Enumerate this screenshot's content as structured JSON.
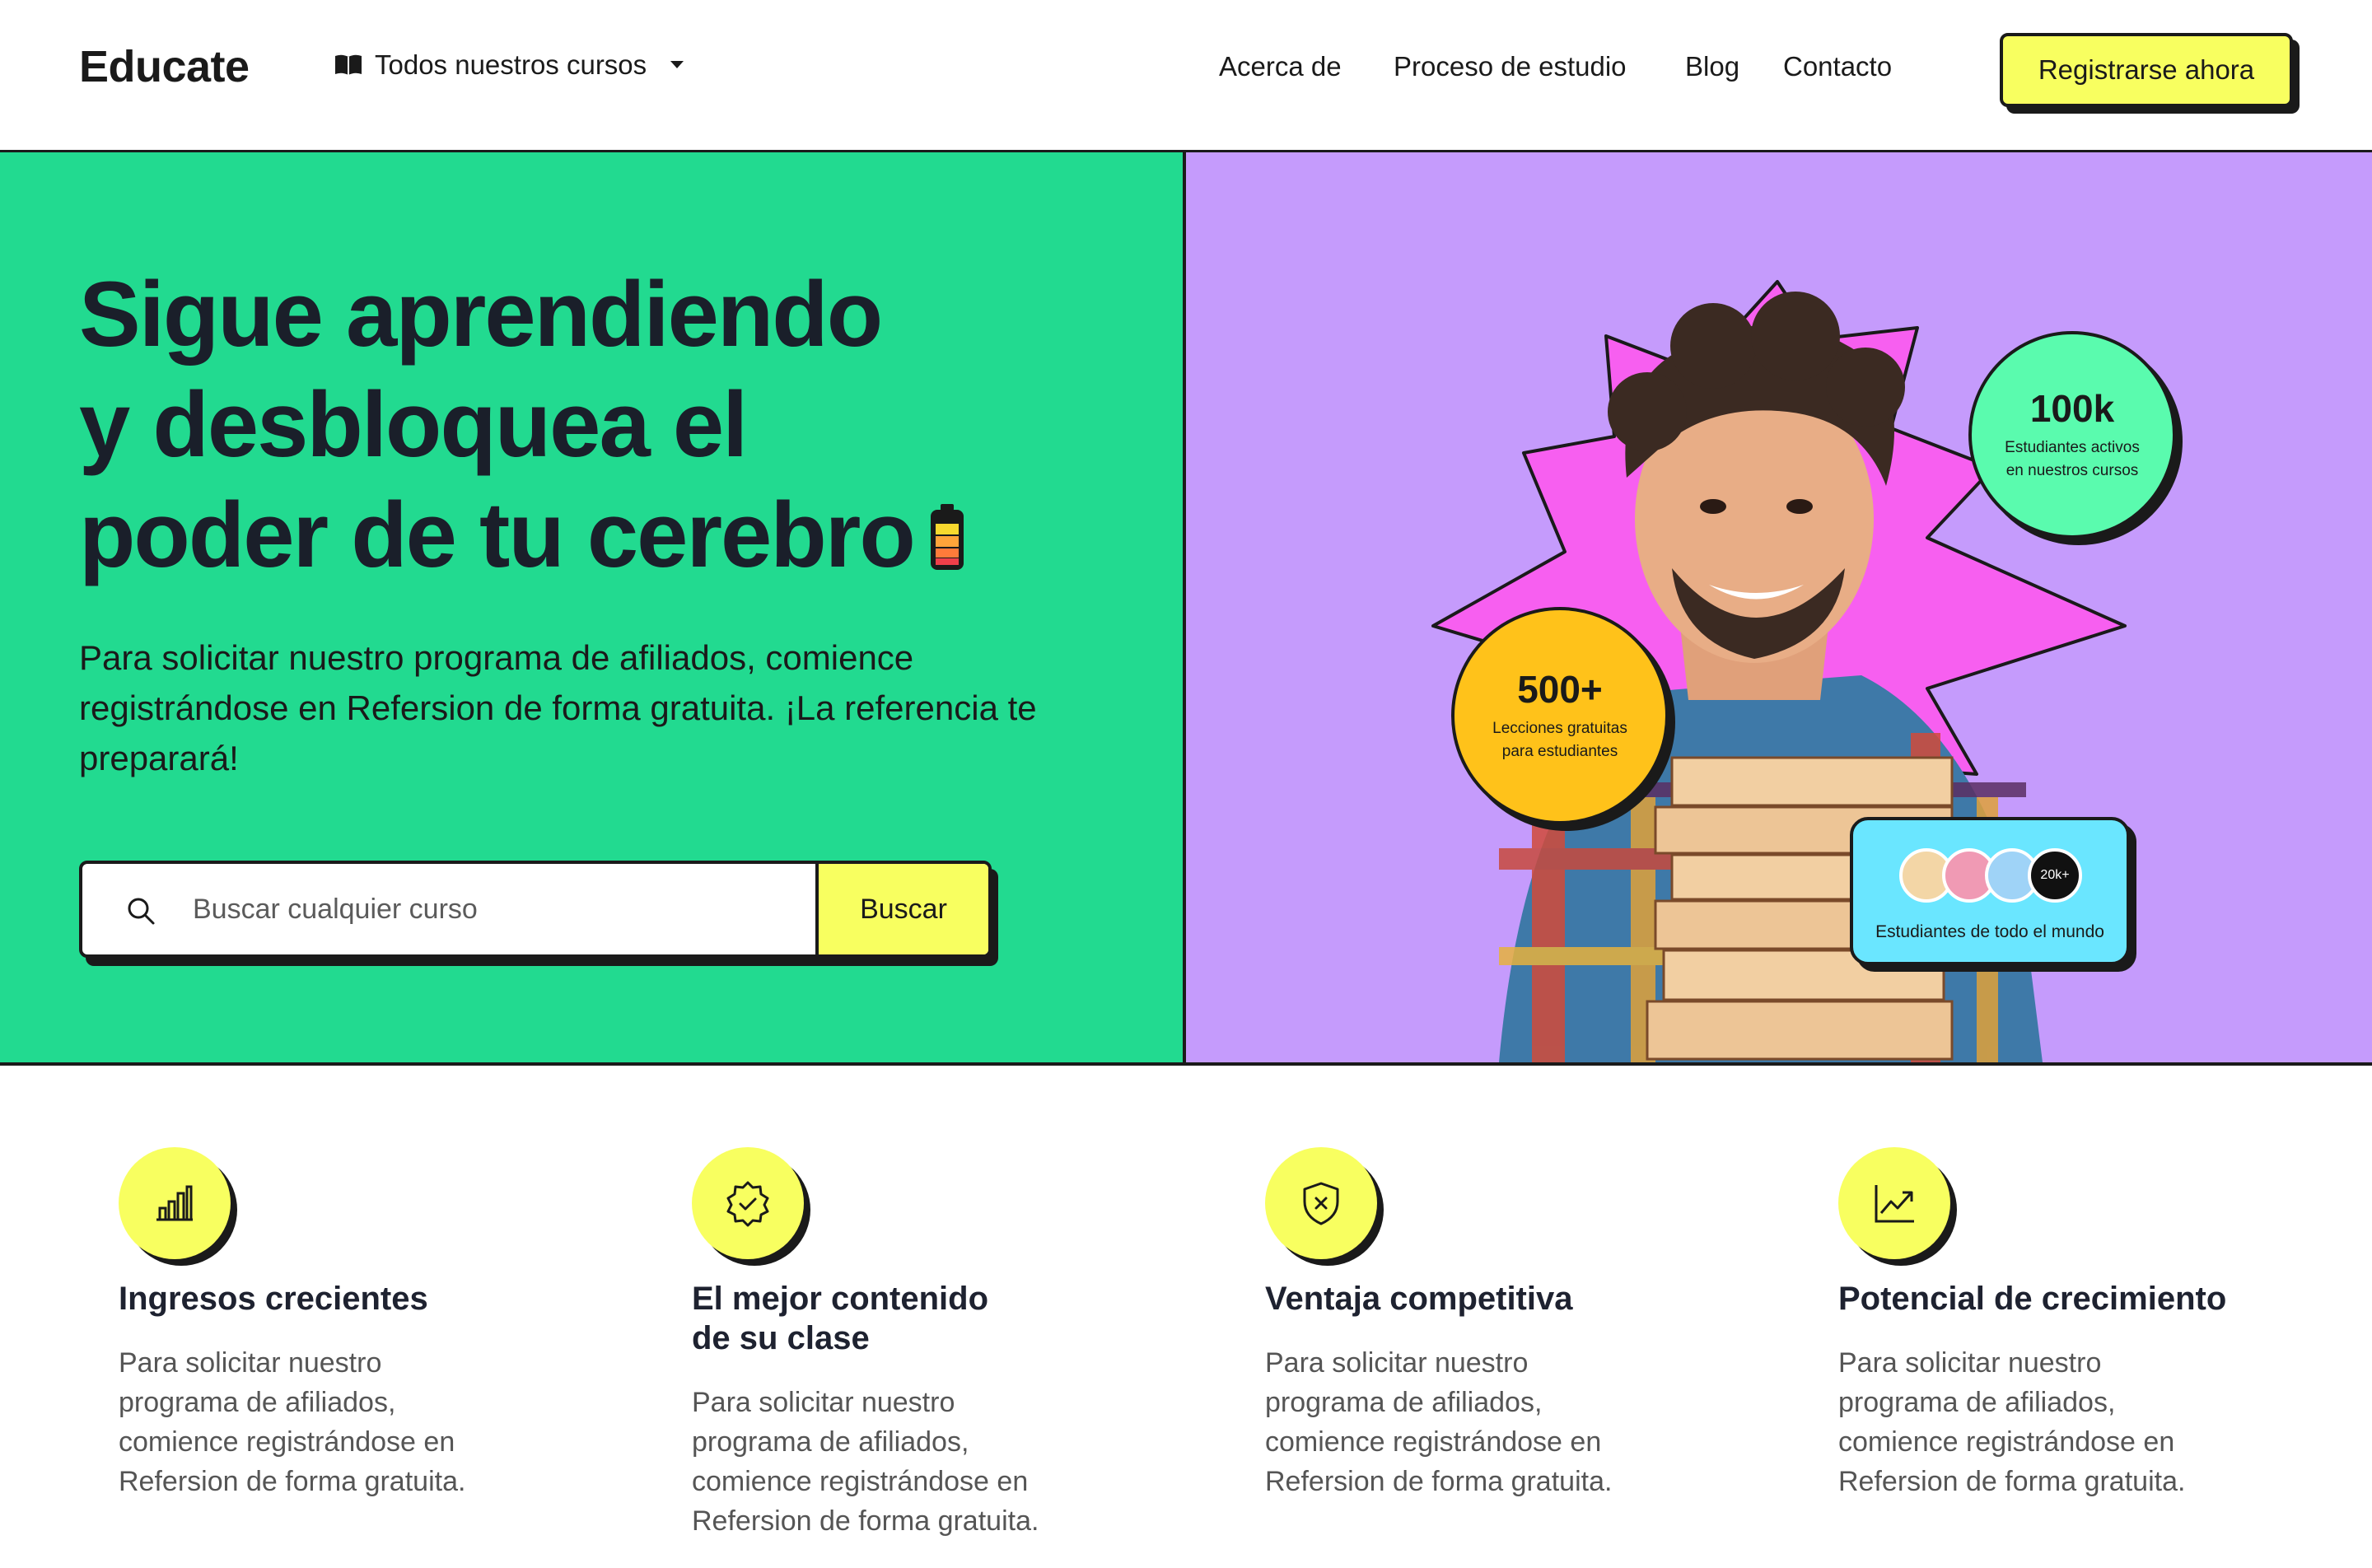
{
  "header": {
    "logo": "Educate",
    "courses_label": "Todos nuestros cursos",
    "nav": [
      {
        "label": "Acerca de"
      },
      {
        "label": "Proceso de estudio"
      },
      {
        "label": "Blog"
      },
      {
        "label": "Contacto"
      }
    ],
    "register_label": "Registrarse ahora"
  },
  "hero": {
    "title_line1": "Sigue aprendiendo",
    "title_line2": "y desbloquea el",
    "title_line3": "poder de tu cerebro",
    "subtitle": "Para solicitar nuestro programa de afiliados, comience registrándose en Refersion de forma gratuita. ¡La referencia te preparará!",
    "search": {
      "placeholder": "Buscar cualquier curso",
      "button_label": "Buscar"
    },
    "stats": {
      "students_value": "100k",
      "students_label": "Estudiantes activos en nuestros cursos",
      "lessons_value": "500+",
      "lessons_label": "Lecciones gratuitas para estudiantes",
      "world_count": "20k+",
      "world_label": "Estudiantes de todo el mundo"
    }
  },
  "features": [
    {
      "icon": "bar-chart-icon",
      "title": "Ingresos crecientes",
      "desc": "Para solicitar nuestro programa de afiliados, comience registrándose en Refersion de forma gratuita."
    },
    {
      "icon": "verified-badge-icon",
      "title": "El mejor contenido de su clase",
      "desc": "Para solicitar nuestro programa de afiliados, comience registrándose en Refersion de forma gratuita."
    },
    {
      "icon": "shield-x-icon",
      "title": "Ventaja competitiva",
      "desc": "Para solicitar nuestro programa de afiliados, comience registrándose en Refersion de forma gratuita."
    },
    {
      "icon": "trending-up-icon",
      "title": "Potencial de crecimiento",
      "desc": "Para solicitar nuestro programa de afiliados, comience registrándose en Refersion de forma gratuita."
    }
  ],
  "colors": {
    "hero_left_bg": "#22da90",
    "hero_right_bg": "#c59bfc",
    "accent_yellow": "#f8ff60",
    "starburst": "#f75ff0",
    "badge_green": "#5afbae",
    "badge_orange": "#ffc21a",
    "card_cyan": "#6ae6ff"
  }
}
